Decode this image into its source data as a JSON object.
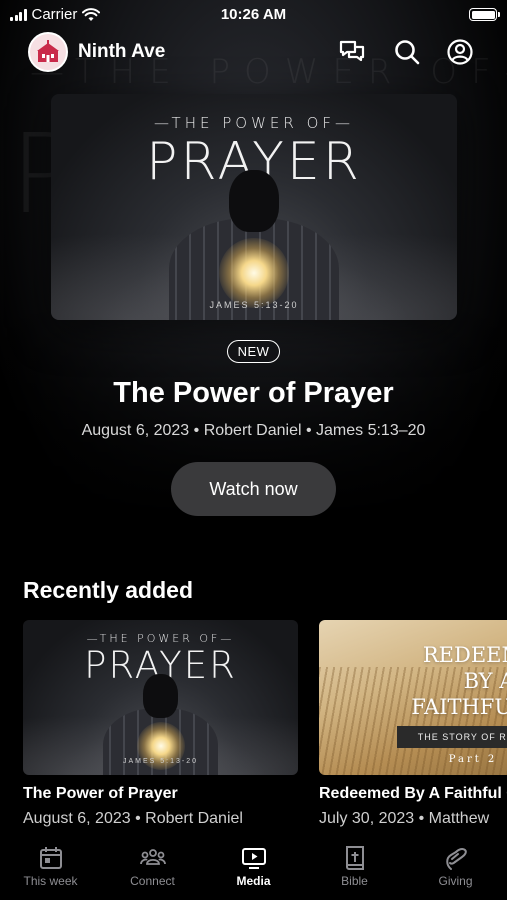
{
  "status_bar": {
    "carrier": "Carrier",
    "time": "10:26 AM"
  },
  "header": {
    "app_name": "Ninth Ave",
    "icons": [
      "church-logo-icon",
      "chat-icon",
      "search-icon",
      "account-icon"
    ]
  },
  "featured": {
    "artwork": {
      "kicker": "—THE POWER OF—",
      "title": "PRAYER",
      "reference": "JAMES 5:13-20"
    },
    "badge": "NEW",
    "title": "The Power of Prayer",
    "meta": "August 6, 2023 • Robert Daniel • James 5:13–20",
    "watch_label": "Watch now"
  },
  "recently_added": {
    "title": "Recently added",
    "items": [
      {
        "title": "The Power of Prayer",
        "meta": "August 6, 2023 • Robert Daniel",
        "artwork": {
          "kicker": "—THE POWER OF—",
          "title": "PRAYER",
          "reference": "JAMES 5:13-20"
        }
      },
      {
        "title": "Redeemed By A Faithful God",
        "meta": "July 30, 2023 • Matthew",
        "artwork": {
          "title": "REDEEMED\nBY A\nFAITHFUL GO",
          "series": "THE STORY OF RUTH",
          "part": "Part 2"
        }
      }
    ]
  },
  "tabs": [
    {
      "label": "This week",
      "icon": "calendar-icon",
      "active": false
    },
    {
      "label": "Connect",
      "icon": "people-icon",
      "active": false
    },
    {
      "label": "Media",
      "icon": "media-icon",
      "active": true
    },
    {
      "label": "Bible",
      "icon": "bible-icon",
      "active": false
    },
    {
      "label": "Giving",
      "icon": "giving-icon",
      "active": false
    }
  ]
}
